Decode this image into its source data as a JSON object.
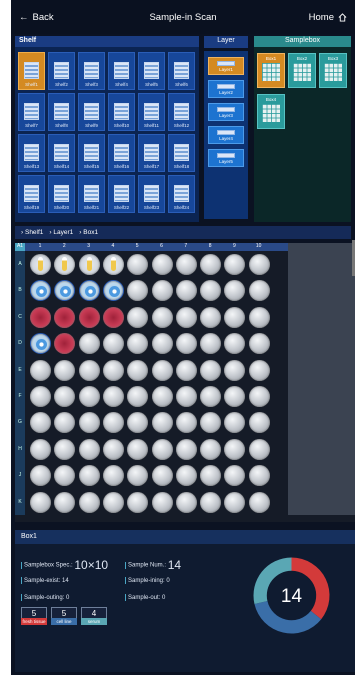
{
  "header": {
    "back_label": "Back",
    "title": "Sample-in Scan",
    "home_label": "Home"
  },
  "shelf_panel": {
    "title": "Shelf",
    "items": [
      "Shelf1",
      "Shelf2",
      "Shelf3",
      "Shelf4",
      "Shelf5",
      "Shelf6",
      "Shelf7",
      "Shelf8",
      "Shelf9",
      "Shelf10",
      "Shelf11",
      "Shelf12",
      "Shelf13",
      "Shelf14",
      "Shelf15",
      "Shelf16",
      "Shelf17",
      "Shelf18",
      "Shelf19",
      "Shelf20",
      "Shelf21",
      "Shelf22",
      "Shelf23",
      "Shelf24"
    ],
    "selected": 0
  },
  "layer_panel": {
    "title": "Layer",
    "items": [
      "Layer1",
      "Layer2",
      "Layer3",
      "Layer4",
      "Layer5"
    ],
    "selected": 0
  },
  "samplebox_panel": {
    "title": "Samplebox",
    "items": [
      "Box1",
      "Box2",
      "Box3",
      "Box4"
    ],
    "selected": 0
  },
  "breadcrumb": [
    "Shelf1",
    "Layer1",
    "Box1"
  ],
  "grid": {
    "corner": "A1",
    "columns": [
      "1",
      "2",
      "3",
      "4",
      "5",
      "6",
      "7",
      "8",
      "9",
      "10"
    ],
    "rows": [
      "A",
      "B",
      "C",
      "D",
      "E",
      "F",
      "G",
      "H",
      "J",
      "K"
    ],
    "filled": {
      "A": [
        "tube",
        "tube",
        "tube",
        "tube"
      ],
      "B": [
        "cell",
        "cell",
        "cell",
        "cell"
      ],
      "C": [
        "tissue",
        "tissue",
        "tissue",
        "tissue"
      ],
      "D": [
        "cell",
        "tissue"
      ]
    }
  },
  "info": {
    "title": "Box1",
    "spec_label": "Samplebox Spec.:",
    "spec_value": "10×10",
    "num_label": "Sample Num.:",
    "num_value": "14",
    "exist_label": "Sample-exist:",
    "exist_value": "14",
    "ining_label": "Sample-ining:",
    "ining_value": "0",
    "outing_label": "Sample-outing:",
    "outing_value": "0",
    "out_label": "Sample-out:",
    "out_value": "0",
    "tags": [
      {
        "count": "5",
        "label": "fresh tissue",
        "color": "#d33a3a"
      },
      {
        "count": "5",
        "label": "cell line",
        "color": "#3a6ea8"
      },
      {
        "count": "4",
        "label": "serum",
        "color": "#5aa7b4"
      }
    ],
    "donut_center": "14"
  },
  "colors": {
    "accent_orange": "#d48a22",
    "shelf_blue": "#17479a",
    "box_teal": "#2a9b9c"
  }
}
